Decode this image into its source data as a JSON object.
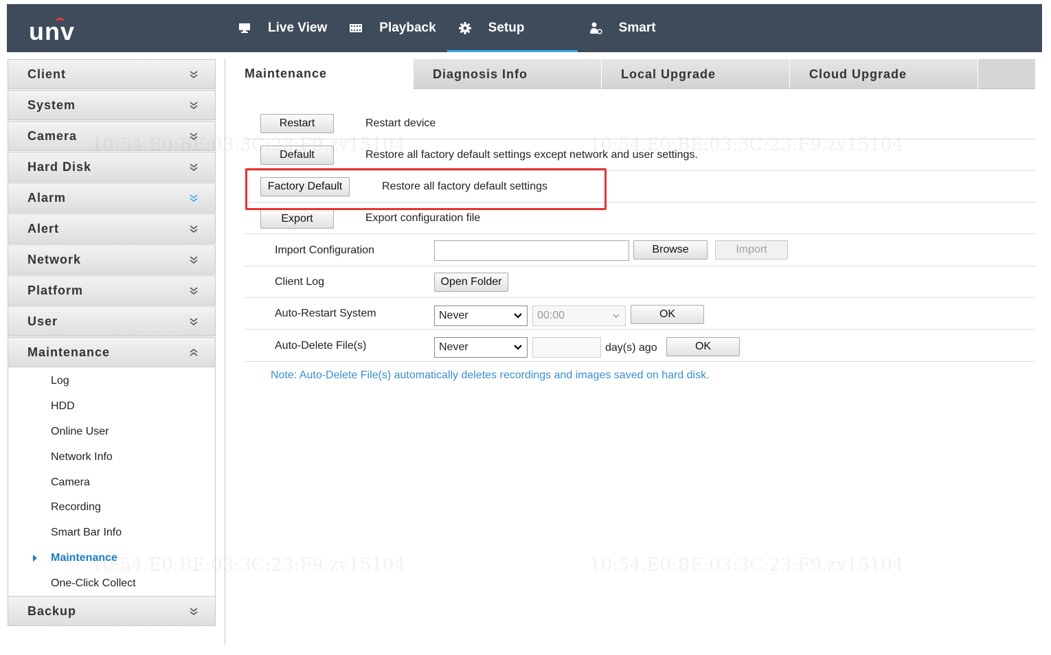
{
  "brand": {
    "logo_text": "UNV"
  },
  "nav": [
    {
      "label": "Live View",
      "icon": "monitor-icon"
    },
    {
      "label": "Playback",
      "icon": "film-icon"
    },
    {
      "label": "Setup",
      "icon": "gear-icon",
      "active": true
    },
    {
      "label": "Smart",
      "icon": "user-smart-icon"
    }
  ],
  "sidebar": {
    "menus": [
      {
        "label": "Client"
      },
      {
        "label": "System"
      },
      {
        "label": "Camera"
      },
      {
        "label": "Hard Disk"
      },
      {
        "label": "Alarm"
      },
      {
        "label": "Alert"
      },
      {
        "label": "Network"
      },
      {
        "label": "Platform"
      },
      {
        "label": "User"
      },
      {
        "label": "Maintenance",
        "expanded": true
      },
      {
        "label": "Backup"
      }
    ],
    "maintenance_items": [
      {
        "label": "Log"
      },
      {
        "label": "HDD"
      },
      {
        "label": "Online User"
      },
      {
        "label": "Network Info"
      },
      {
        "label": "Camera"
      },
      {
        "label": "Recording"
      },
      {
        "label": "Smart Bar Info"
      },
      {
        "label": "Maintenance",
        "active": true
      },
      {
        "label": "One-Click Collect"
      }
    ]
  },
  "tabs": [
    {
      "label": "Maintenance",
      "active": true
    },
    {
      "label": "Diagnosis Info"
    },
    {
      "label": "Local Upgrade"
    },
    {
      "label": "Cloud Upgrade"
    }
  ],
  "maintenance": {
    "restart": {
      "button": "Restart",
      "desc": "Restart device"
    },
    "default": {
      "button": "Default",
      "desc": "Restore all factory default settings except network and user settings."
    },
    "factory_default": {
      "button": "Factory Default",
      "desc": "Restore all factory default settings"
    },
    "export": {
      "button": "Export",
      "desc": "Export configuration file"
    },
    "import_config": {
      "label": "Import Configuration",
      "value": "",
      "browse": "Browse",
      "import": "Import"
    },
    "client_log": {
      "label": "Client Log",
      "button": "Open Folder"
    },
    "auto_restart": {
      "label": "Auto-Restart System",
      "frequency": "Never",
      "time": "00:00",
      "ok": "OK"
    },
    "auto_delete": {
      "label": "Auto-Delete File(s)",
      "frequency": "Never",
      "days": "",
      "days_suffix": "day(s) ago",
      "ok": "OK"
    },
    "note": "Note: Auto-Delete File(s) automatically deletes recordings and images saved on hard disk."
  },
  "watermark": "10:54.E0:BE:03:3C:23:F9.zv15104",
  "colors": {
    "topbar": "#3d4b5a",
    "accent": "#3aa7e8",
    "link": "#1a7dc4",
    "highlight": "#e63232"
  }
}
